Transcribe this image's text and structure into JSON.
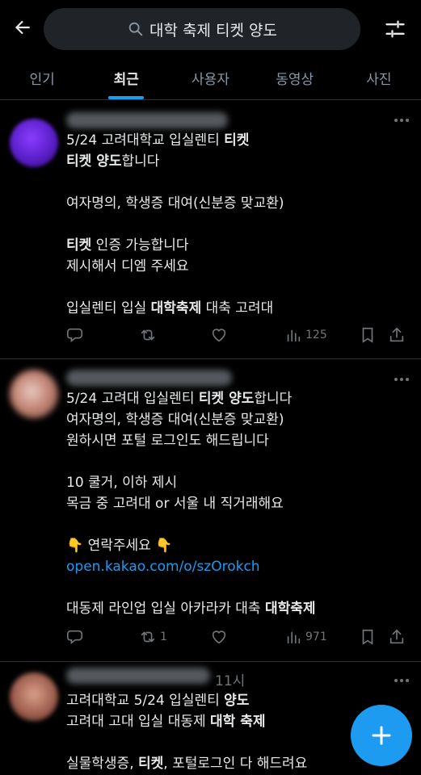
{
  "search": {
    "query": "대학 축제 티켓 양도"
  },
  "tabs": [
    {
      "label": "인기"
    },
    {
      "label": "최근"
    },
    {
      "label": "사용자"
    },
    {
      "label": "동영상"
    },
    {
      "label": "사진"
    }
  ],
  "active_tab": "최근",
  "posts": [
    {
      "lines": [
        [
          {
            "t": "5/24 고려대학교 입실렌티 "
          },
          {
            "t": "티켓",
            "b": true
          }
        ],
        [
          {
            "t": "티켓 양도",
            "b": true
          },
          {
            "t": "합니다"
          }
        ],
        [],
        [
          {
            "t": "여자명의, 학생증 대여(신분증 맞교환)"
          }
        ],
        [],
        [
          {
            "t": "티켓",
            "b": true
          },
          {
            "t": " 인증 가능합니다"
          }
        ],
        [
          {
            "t": "제시해서 디엠 주세요"
          }
        ],
        [],
        [
          {
            "t": "입실렌티 입실 "
          },
          {
            "t": "대학축제",
            "b": true
          },
          {
            "t": " 대축 고려대"
          }
        ]
      ],
      "replies": "",
      "reposts": "",
      "views": "125"
    },
    {
      "lines": [
        [
          {
            "t": "5/24 고려대 입실렌티 "
          },
          {
            "t": "티켓 양도",
            "b": true
          },
          {
            "t": "합니다"
          }
        ],
        [
          {
            "t": "여자명의, 학생증 대여(신분증 맞교환)"
          }
        ],
        [
          {
            "t": "원하시면 포털 로그인도 해드립니다"
          }
        ],
        [],
        [
          {
            "t": "10 쿨거, 이하 제시"
          }
        ],
        [
          {
            "t": "목금 중 고려대 or 서울 내 직거래해요"
          }
        ],
        [],
        [
          {
            "t": "👇 연락주세요 👇"
          }
        ],
        [
          {
            "t": "open.kakao.com/o/szOrokch",
            "link": true
          }
        ],
        [],
        [
          {
            "t": "대동제 라인업 입실 아카라카 대축 "
          },
          {
            "t": "대학축제",
            "b": true
          }
        ]
      ],
      "replies": "",
      "reposts": "1",
      "views": "971"
    },
    {
      "time": "11시",
      "lines": [
        [
          {
            "t": "고려대학교 5/24 입실렌티 "
          },
          {
            "t": "양도",
            "b": true
          }
        ],
        [
          {
            "t": "고려대 고대 입실 대동제 "
          },
          {
            "t": "대학 축제",
            "b": true
          }
        ],
        [],
        [
          {
            "t": "실물학생증, "
          },
          {
            "t": "티켓",
            "b": true
          },
          {
            "t": ", 포털로그인 다 해드려요"
          }
        ]
      ]
    }
  ],
  "colors": {
    "accent": "#1d9bf0",
    "background": "#000000",
    "muted": "#71767b"
  }
}
